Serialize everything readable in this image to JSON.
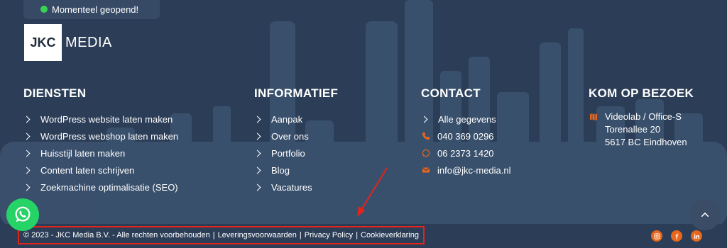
{
  "status": {
    "text": "Momenteel geopend!",
    "dot_color": "#39d353"
  },
  "logo": {
    "box_text": "JKC",
    "text": "MEDIA"
  },
  "diensten": {
    "heading": "DIENSTEN",
    "items": [
      "WordPress website laten maken",
      "WordPress webshop laten maken",
      "Huisstijl laten maken",
      "Content laten schrijven",
      "Zoekmachine optimalisatie (SEO)"
    ]
  },
  "informatief": {
    "heading": "INFORMATIEF",
    "items": [
      "Aanpak",
      "Over ons",
      "Portfolio",
      "Blog",
      "Vacatures"
    ]
  },
  "contact": {
    "heading": "CONTACT",
    "all_label": "Alle gegevens",
    "phone": "040 369 0296",
    "whatsapp": "06 2373 1420",
    "email": "info@jkc-media.nl"
  },
  "visit": {
    "heading": "KOM OP BEZOEK",
    "line1": "Videolab / Office-S",
    "line2": "Torenallee 20",
    "line3": "5617 BC Eindhoven"
  },
  "footer": {
    "copyright": "© 2023 - JKC Media B.V. - Alle rechten voorbehouden",
    "sep": "|",
    "links": [
      "Leveringsvoorwaarden",
      "Privacy Policy",
      "Cookieverklaring"
    ]
  },
  "colors": {
    "background": "#2c3e57",
    "accent": "#e8671c",
    "highlight": "#e2241b",
    "whatsapp": "#25d366"
  },
  "icons": [
    "whatsapp-icon",
    "chevron-up-icon",
    "instagram-icon",
    "facebook-icon",
    "linkedin-icon",
    "phone-icon",
    "email-icon",
    "map-icon"
  ]
}
